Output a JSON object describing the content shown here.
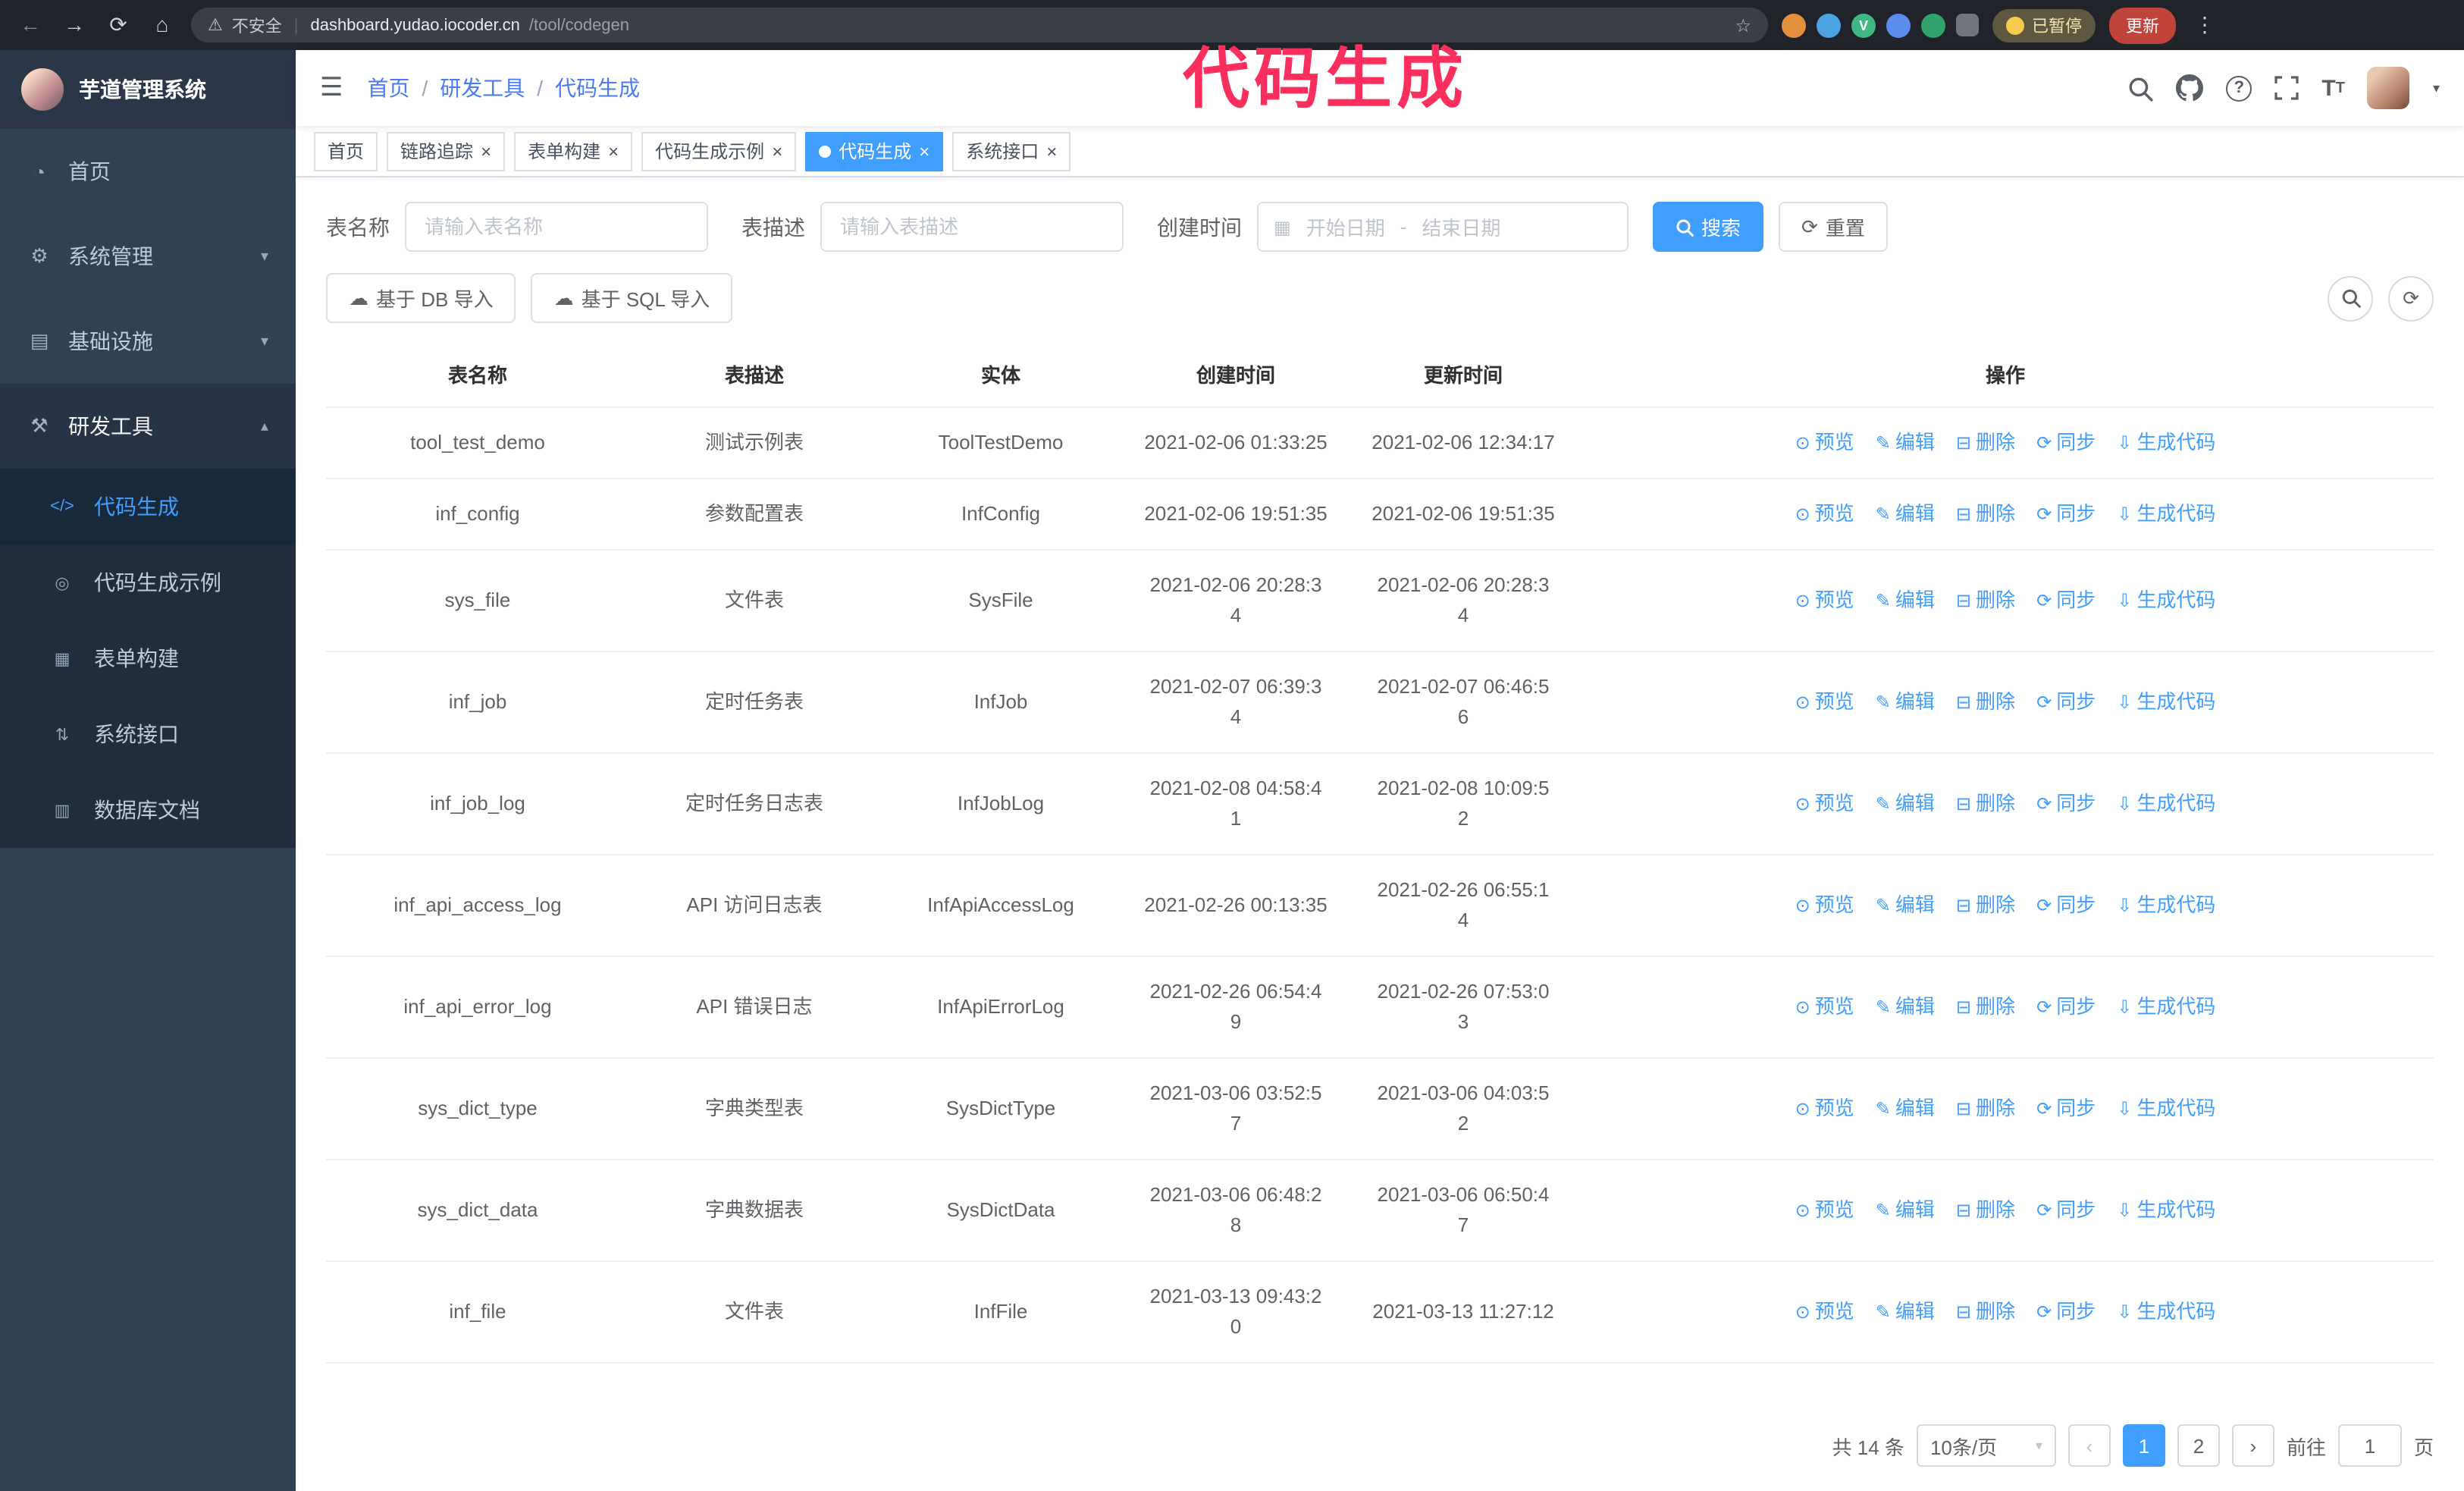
{
  "accent_color": "#409eff",
  "annotation": {
    "text": "代码生成",
    "color": "#fb2f5e"
  },
  "browser": {
    "security_warning": "不安全",
    "url_domain": "dashboard.yudao.iocoder.cn",
    "url_path": "/tool/codegen",
    "paused_badge": "已暂停",
    "update_button": "更新",
    "extension_v": "V"
  },
  "icons": {
    "back": "←",
    "forward": "→",
    "reload": "⟳",
    "home": "⌂",
    "warning": "⚠",
    "divider": "|",
    "star": "☆",
    "menu_dots": "⋮",
    "hamburger": "☰",
    "slash": "/",
    "question": "?",
    "caret_down": "▾",
    "caret_up": "▴",
    "calendar": "▦",
    "refresh": "⟳",
    "upload": "☁",
    "prev": "‹",
    "next": "›",
    "close": "×",
    "font_large": "T",
    "font_small": "T"
  },
  "sidebar": {
    "logo_title": "芋道管理系统",
    "items": [
      {
        "label": "首页",
        "icon_glyph": "◔"
      },
      {
        "label": "系统管理",
        "icon_glyph": "⚙"
      },
      {
        "label": "基础设施",
        "icon_glyph": "▤"
      },
      {
        "label": "研发工具",
        "icon_glyph": "⚒"
      }
    ],
    "subitems": [
      {
        "label": "代码生成",
        "icon_glyph": "</>",
        "active": true
      },
      {
        "label": "代码生成示例",
        "icon_glyph": "◎"
      },
      {
        "label": "表单构建",
        "icon_glyph": "▦"
      },
      {
        "label": "系统接口",
        "icon_glyph": "⇅"
      },
      {
        "label": "数据库文档",
        "icon_glyph": "▥"
      }
    ]
  },
  "header": {
    "breadcrumb": [
      "首页",
      "研发工具",
      "代码生成"
    ]
  },
  "tabs": [
    {
      "label": "首页",
      "closable": false,
      "active": false
    },
    {
      "label": "链路追踪",
      "closable": true,
      "active": false
    },
    {
      "label": "表单构建",
      "closable": true,
      "active": false
    },
    {
      "label": "代码生成示例",
      "closable": true,
      "active": false
    },
    {
      "label": "代码生成",
      "closable": true,
      "active": true
    },
    {
      "label": "系统接口",
      "closable": true,
      "active": false
    }
  ],
  "filters": {
    "table_name_label": "表名称",
    "table_name_placeholder": "请输入表名称",
    "table_desc_label": "表描述",
    "table_desc_placeholder": "请输入表描述",
    "create_time_label": "创建时间",
    "date_start_placeholder": "开始日期",
    "date_separator": "-",
    "date_end_placeholder": "结束日期",
    "search_button": "搜索",
    "reset_button": "重置"
  },
  "toolbar": {
    "import_db": "基于 DB 导入",
    "import_sql": "基于 SQL 导入"
  },
  "table": {
    "columns": [
      "表名称",
      "表描述",
      "实体",
      "创建时间",
      "更新时间",
      "操作"
    ],
    "actions": [
      {
        "name": "preview",
        "label": "预览",
        "icon": "⊙"
      },
      {
        "name": "edit",
        "label": "编辑",
        "icon": "✎"
      },
      {
        "name": "delete",
        "label": "删除",
        "icon": "⊟"
      },
      {
        "name": "sync",
        "label": "同步",
        "icon": "⟳"
      },
      {
        "name": "generate",
        "label": "生成代码",
        "icon": "⇩"
      }
    ],
    "rows": [
      {
        "name": "tool_test_demo",
        "desc": "测试示例表",
        "entity": "ToolTestDemo",
        "create_time": "2021-02-06 01:33:25",
        "update_time": "2021-02-06 12:34:17"
      },
      {
        "name": "inf_config",
        "desc": "参数配置表",
        "entity": "InfConfig",
        "create_time": "2021-02-06 19:51:35",
        "update_time": "2021-02-06 19:51:35"
      },
      {
        "name": "sys_file",
        "desc": "文件表",
        "entity": "SysFile",
        "create_time": "2021-02-06 20:28:3\n4",
        "update_time": "2021-02-06 20:28:3\n4"
      },
      {
        "name": "inf_job",
        "desc": "定时任务表",
        "entity": "InfJob",
        "create_time": "2021-02-07 06:39:3\n4",
        "update_time": "2021-02-07 06:46:5\n6"
      },
      {
        "name": "inf_job_log",
        "desc": "定时任务日志表",
        "entity": "InfJobLog",
        "create_time": "2021-02-08 04:58:4\n1",
        "update_time": "2021-02-08 10:09:5\n2"
      },
      {
        "name": "inf_api_access_log",
        "desc": "API 访问日志表",
        "entity": "InfApiAccessLog",
        "create_time": "2021-02-26 00:13:35",
        "update_time": "2021-02-26 06:55:1\n4"
      },
      {
        "name": "inf_api_error_log",
        "desc": "API 错误日志",
        "entity": "InfApiErrorLog",
        "create_time": "2021-02-26 06:54:4\n9",
        "update_time": "2021-02-26 07:53:0\n3"
      },
      {
        "name": "sys_dict_type",
        "desc": "字典类型表",
        "entity": "SysDictType",
        "create_time": "2021-03-06 03:52:5\n7",
        "update_time": "2021-03-06 04:03:5\n2"
      },
      {
        "name": "sys_dict_data",
        "desc": "字典数据表",
        "entity": "SysDictData",
        "create_time": "2021-03-06 06:48:2\n8",
        "update_time": "2021-03-06 06:50:4\n7"
      },
      {
        "name": "inf_file",
        "desc": "文件表",
        "entity": "InfFile",
        "create_time": "2021-03-13 09:43:2\n0",
        "update_time": "2021-03-13 11:27:12"
      }
    ]
  },
  "pagination": {
    "total": "共 14 条",
    "page_size": "10条/页",
    "pages": [
      "1",
      "2"
    ],
    "active_page": "1",
    "goto_label": "前往",
    "goto_value": "1",
    "goto_suffix": "页"
  }
}
